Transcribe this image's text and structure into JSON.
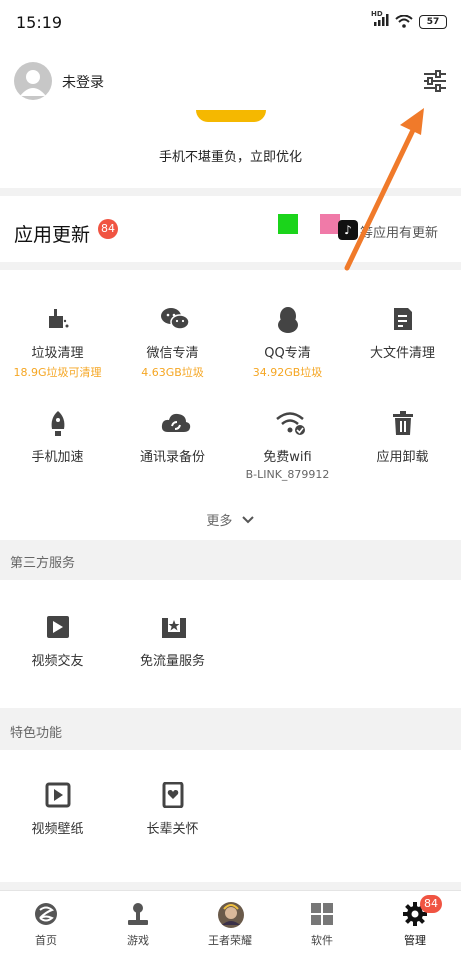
{
  "status_bar": {
    "time": "15:19",
    "battery": "57",
    "network": "HD"
  },
  "header": {
    "login_label": "未登录",
    "slogan": "手机不堪重负，立即优化"
  },
  "update": {
    "title": "应用更新",
    "badge": "84",
    "right_text": "等应用有更新",
    "tiktok_glyph": "♪"
  },
  "tools": [
    {
      "label": "垃圾清理",
      "sub": "18.9G垃圾可清理",
      "icon": "broom-icon"
    },
    {
      "label": "微信专清",
      "sub": "4.63GB垃圾",
      "icon": "wechat-icon"
    },
    {
      "label": "QQ专清",
      "sub": "34.92GB垃圾",
      "icon": "qq-penguin-icon"
    },
    {
      "label": "大文件清理",
      "sub": "",
      "icon": "document-icon"
    },
    {
      "label": "手机加速",
      "sub": "",
      "icon": "rocket-icon"
    },
    {
      "label": "通讯录备份",
      "sub": "",
      "icon": "cloud-sync-icon"
    },
    {
      "label": "免费wifi",
      "sub": "B-LINK_879912",
      "icon": "wifi-check-icon"
    },
    {
      "label": "应用卸载",
      "sub": "",
      "icon": "trash-icon"
    }
  ],
  "more_label": "更多",
  "third_party": {
    "title": "第三方服务",
    "items": [
      {
        "label": "视频交友",
        "icon": "video-dating-icon"
      },
      {
        "label": "免流量服务",
        "icon": "free-data-icon"
      }
    ]
  },
  "features": {
    "title": "特色功能",
    "items": [
      {
        "label": "视频壁纸",
        "icon": "video-wallpaper-icon"
      },
      {
        "label": "长辈关怀",
        "icon": "elder-care-icon"
      }
    ]
  },
  "nav": {
    "items": [
      {
        "label": "首页",
        "icon": "home-icon"
      },
      {
        "label": "游戏",
        "icon": "joystick-icon"
      },
      {
        "label": "王者荣耀",
        "icon": "game-avatar-icon"
      },
      {
        "label": "软件",
        "icon": "apps-grid-icon"
      },
      {
        "label": "管理",
        "icon": "gear-icon"
      }
    ],
    "badge": "84"
  },
  "colors": {
    "accent": "#f5a623",
    "badge": "#f05442",
    "icon": "#444444",
    "arrow": "#f07a2a"
  }
}
